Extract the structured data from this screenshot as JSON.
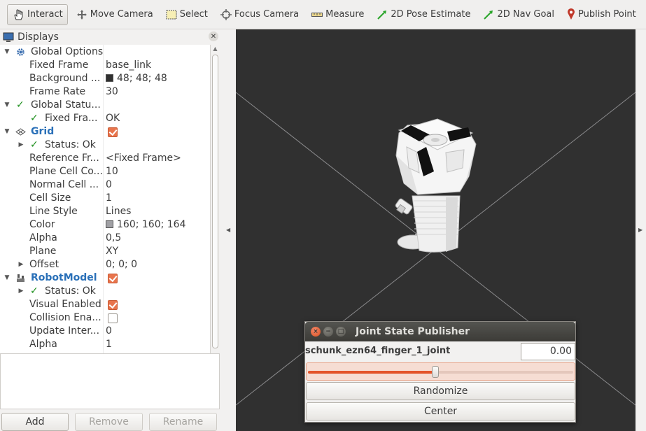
{
  "toolbar": {
    "tools": [
      {
        "label": "Interact",
        "icon": "cursor-hand-icon",
        "active": true
      },
      {
        "label": "Move Camera",
        "icon": "move-arrows-icon"
      },
      {
        "label": "Select",
        "icon": "select-rectangle-icon"
      },
      {
        "label": "Focus Camera",
        "icon": "crosshair-icon"
      },
      {
        "label": "Measure",
        "icon": "ruler-icon"
      },
      {
        "label": "2D Pose Estimate",
        "icon": "green-arrow-icon"
      },
      {
        "label": "2D Nav Goal",
        "icon": "green-arrow-icon"
      },
      {
        "label": "Publish Point",
        "icon": "map-pin-icon"
      }
    ],
    "add_icon": "plus-icon",
    "minus_icon": "minus-icon"
  },
  "displays": {
    "title": "Displays",
    "rows": {
      "global_options": "Global Options",
      "fixed_frame_label": "Fixed Frame",
      "fixed_frame_value": "base_link",
      "background_label": "Background ...",
      "background_value": "48; 48; 48",
      "frame_rate_label": "Frame Rate",
      "frame_rate_value": "30",
      "global_status": "Global Statu...",
      "fixed_frame_status_label": "Fixed Fra...",
      "fixed_frame_status_value": "OK",
      "grid": "Grid",
      "grid_status": "Status: Ok",
      "reference_frame_label": "Reference Fr...",
      "reference_frame_value": "<Fixed Frame>",
      "plane_cell_count_label": "Plane Cell Co...",
      "plane_cell_count_value": "10",
      "normal_cell_label": "Normal Cell ...",
      "normal_cell_value": "0",
      "cell_size_label": "Cell Size",
      "cell_size_value": "1",
      "line_style_label": "Line Style",
      "line_style_value": "Lines",
      "color_label": "Color",
      "color_value": "160; 160; 164",
      "alpha_label": "Alpha",
      "alpha_value": "0,5",
      "plane_label": "Plane",
      "plane_value": "XY",
      "offset_label": "Offset",
      "offset_value": "0; 0; 0",
      "robot_model": "RobotModel",
      "robot_status": "Status: Ok",
      "visual_enabled_label": "Visual Enabled",
      "collision_label": "Collision Ena...",
      "update_interval_label": "Update Inter...",
      "update_interval_value": "0",
      "robot_alpha_label": "Alpha",
      "robot_alpha_value": "1"
    },
    "checkboxes": {
      "grid": true,
      "robot_model": true,
      "visual_enabled": true,
      "collision_enabled": false
    },
    "colors": {
      "background": "#303030",
      "grid_color": "#a0a0a4"
    },
    "buttons": {
      "add": "Add",
      "remove": "Remove",
      "rename": "Rename"
    }
  },
  "joint_state_publisher": {
    "title": "Joint State Publisher",
    "joint_name": "schunk_ezn64_finger_1_joint",
    "joint_value": "0.00",
    "slider_fraction": 0.48,
    "randomize_label": "Randomize",
    "center_label": "Center"
  }
}
